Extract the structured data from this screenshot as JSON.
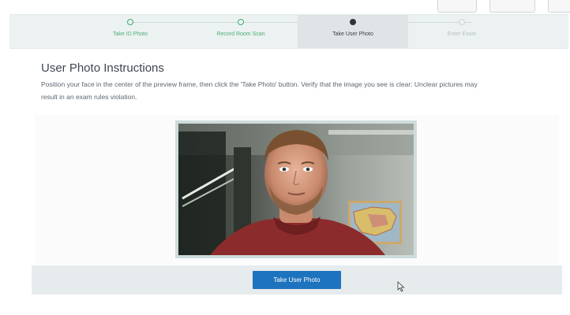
{
  "stepper": {
    "steps": [
      {
        "label": "Take ID Photo",
        "state": "complete"
      },
      {
        "label": "Record Room Scan",
        "state": "complete"
      },
      {
        "label": "Take User Photo",
        "state": "active"
      },
      {
        "label": "Enter Exam",
        "state": "pending"
      }
    ]
  },
  "instructions": {
    "title": "User Photo Instructions",
    "description": "Position your face in the center of the preview frame, then click the 'Take Photo' button. Verify that the image you see is clear: Unclear pictures may result in an exam rules violation."
  },
  "camera": {
    "icon": "webcam-preview"
  },
  "actions": {
    "take_photo_label": "Take User Photo"
  },
  "colors": {
    "accent": "#1e73be",
    "complete": "#3cae6e",
    "stepper_bg": "#ecf1f1",
    "active_step_bg": "#dfe4e6",
    "footer_bg": "#e6ebee"
  }
}
